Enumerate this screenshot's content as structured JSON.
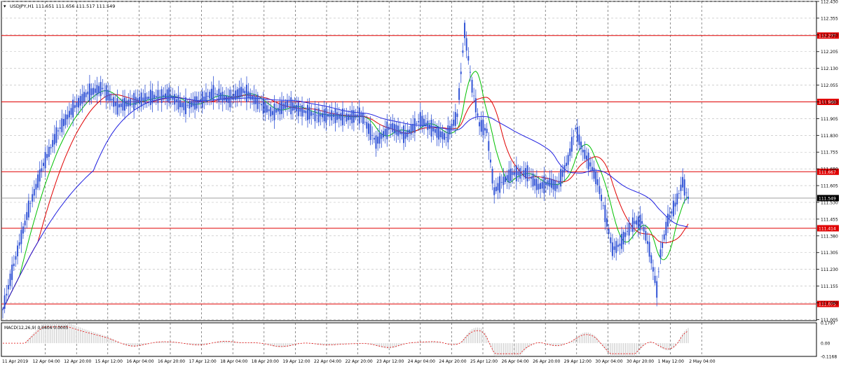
{
  "window": {
    "symbol_header": "USDJPY,H1  111.651 111.656 111.517 111.549",
    "menu_glyph": "▾"
  },
  "chart_data": [
    {
      "type": "candlestick",
      "title": "USDJPY,H1  111.651 111.656 111.517 111.549",
      "ylim": [
        111.0,
        112.43
      ],
      "y_ticks": [
        "112.430",
        "112.355",
        "112.280",
        "112.205",
        "112.130",
        "112.055",
        "111.980",
        "111.905",
        "111.830",
        "111.755",
        "111.680",
        "111.605",
        "111.530",
        "111.455",
        "111.380",
        "111.305",
        "111.230",
        "111.155",
        "111.080",
        "111.005"
      ],
      "x_tick_labels": [
        "11 Apr 2019",
        "12 Apr 04:00",
        "12 Apr 20:00",
        "15 Apr 12:00",
        "16 Apr 04:00",
        "16 Apr 20:00",
        "17 Apr 12:00",
        "18 Apr 04:00",
        "18 Apr 20:00",
        "19 Apr 12:00",
        "22 Apr 04:00",
        "22 Apr 20:00",
        "23 Apr 12:00",
        "24 Apr 04:00",
        "24 Apr 20:00",
        "25 Apr 12:00",
        "26 Apr 04:00",
        "26 Apr 20:00",
        "29 Apr 12:00",
        "30 Apr 04:00",
        "30 Apr 20:00",
        "1 May 12:00",
        "2 May 04:00"
      ],
      "grid": true,
      "current_price": {
        "label": "111.549",
        "value": 111.549
      },
      "horizontal_levels": [
        {
          "label": "112.277",
          "value": 112.277
        },
        {
          "label": "111.980",
          "value": 111.98
        },
        {
          "label": "111.667",
          "value": 111.667
        },
        {
          "label": "111.414",
          "value": 111.414
        },
        {
          "label": "111.075",
          "value": 111.075
        }
      ],
      "price_path": [
        [
          0,
          111.05
        ],
        [
          6,
          111.25
        ],
        [
          14,
          111.5
        ],
        [
          22,
          111.7
        ],
        [
          30,
          111.85
        ],
        [
          38,
          111.95
        ],
        [
          46,
          112.02
        ],
        [
          54,
          112.04
        ],
        [
          62,
          111.96
        ],
        [
          70,
          111.98
        ],
        [
          80,
          112.0
        ],
        [
          90,
          112.01
        ],
        [
          98,
          111.96
        ],
        [
          106,
          111.98
        ],
        [
          114,
          112.02
        ],
        [
          122,
          111.99
        ],
        [
          130,
          112.03
        ],
        [
          138,
          111.98
        ],
        [
          146,
          111.93
        ],
        [
          154,
          111.97
        ],
        [
          162,
          111.94
        ],
        [
          170,
          111.92
        ],
        [
          178,
          111.92
        ],
        [
          186,
          111.91
        ],
        [
          194,
          111.92
        ],
        [
          202,
          111.8
        ],
        [
          210,
          111.87
        ],
        [
          218,
          111.83
        ],
        [
          226,
          111.9
        ],
        [
          234,
          111.85
        ],
        [
          240,
          111.82
        ],
        [
          246,
          111.92
        ],
        [
          250,
          112.3
        ],
        [
          254,
          112.05
        ],
        [
          258,
          111.88
        ],
        [
          262,
          111.85
        ],
        [
          266,
          111.58
        ],
        [
          270,
          111.62
        ],
        [
          276,
          111.66
        ],
        [
          284,
          111.66
        ],
        [
          290,
          111.6
        ],
        [
          296,
          111.62
        ],
        [
          300,
          111.6
        ],
        [
          306,
          111.72
        ],
        [
          310,
          111.86
        ],
        [
          314,
          111.76
        ],
        [
          318,
          111.7
        ],
        [
          322,
          111.62
        ],
        [
          326,
          111.48
        ],
        [
          330,
          111.32
        ],
        [
          334,
          111.34
        ],
        [
          338,
          111.4
        ],
        [
          342,
          111.44
        ],
        [
          346,
          111.44
        ],
        [
          350,
          111.32
        ],
        [
          354,
          111.14
        ],
        [
          356,
          111.3
        ],
        [
          360,
          111.45
        ],
        [
          364,
          111.52
        ],
        [
          368,
          111.62
        ],
        [
          371,
          111.55
        ]
      ],
      "moving_averages": [
        {
          "color": "#00c000",
          "period_note": "fast"
        },
        {
          "color": "#e00000",
          "period_note": "medium"
        },
        {
          "color": "#2020e0",
          "period_note": "slow"
        }
      ]
    },
    {
      "type": "histogram",
      "title": "MACD(12,26,9) 0.0404 0.0005",
      "ylim": [
        -0.1168,
        0.1797
      ],
      "y_ticks": [
        "0.1797",
        "0.00",
        "-0.1168"
      ]
    }
  ],
  "colors": {
    "candle": "#3355d6",
    "level_line": "#e00000",
    "grid": "#b8b8b8",
    "signal": "#e00000",
    "histogram": "#c8c8c8"
  }
}
